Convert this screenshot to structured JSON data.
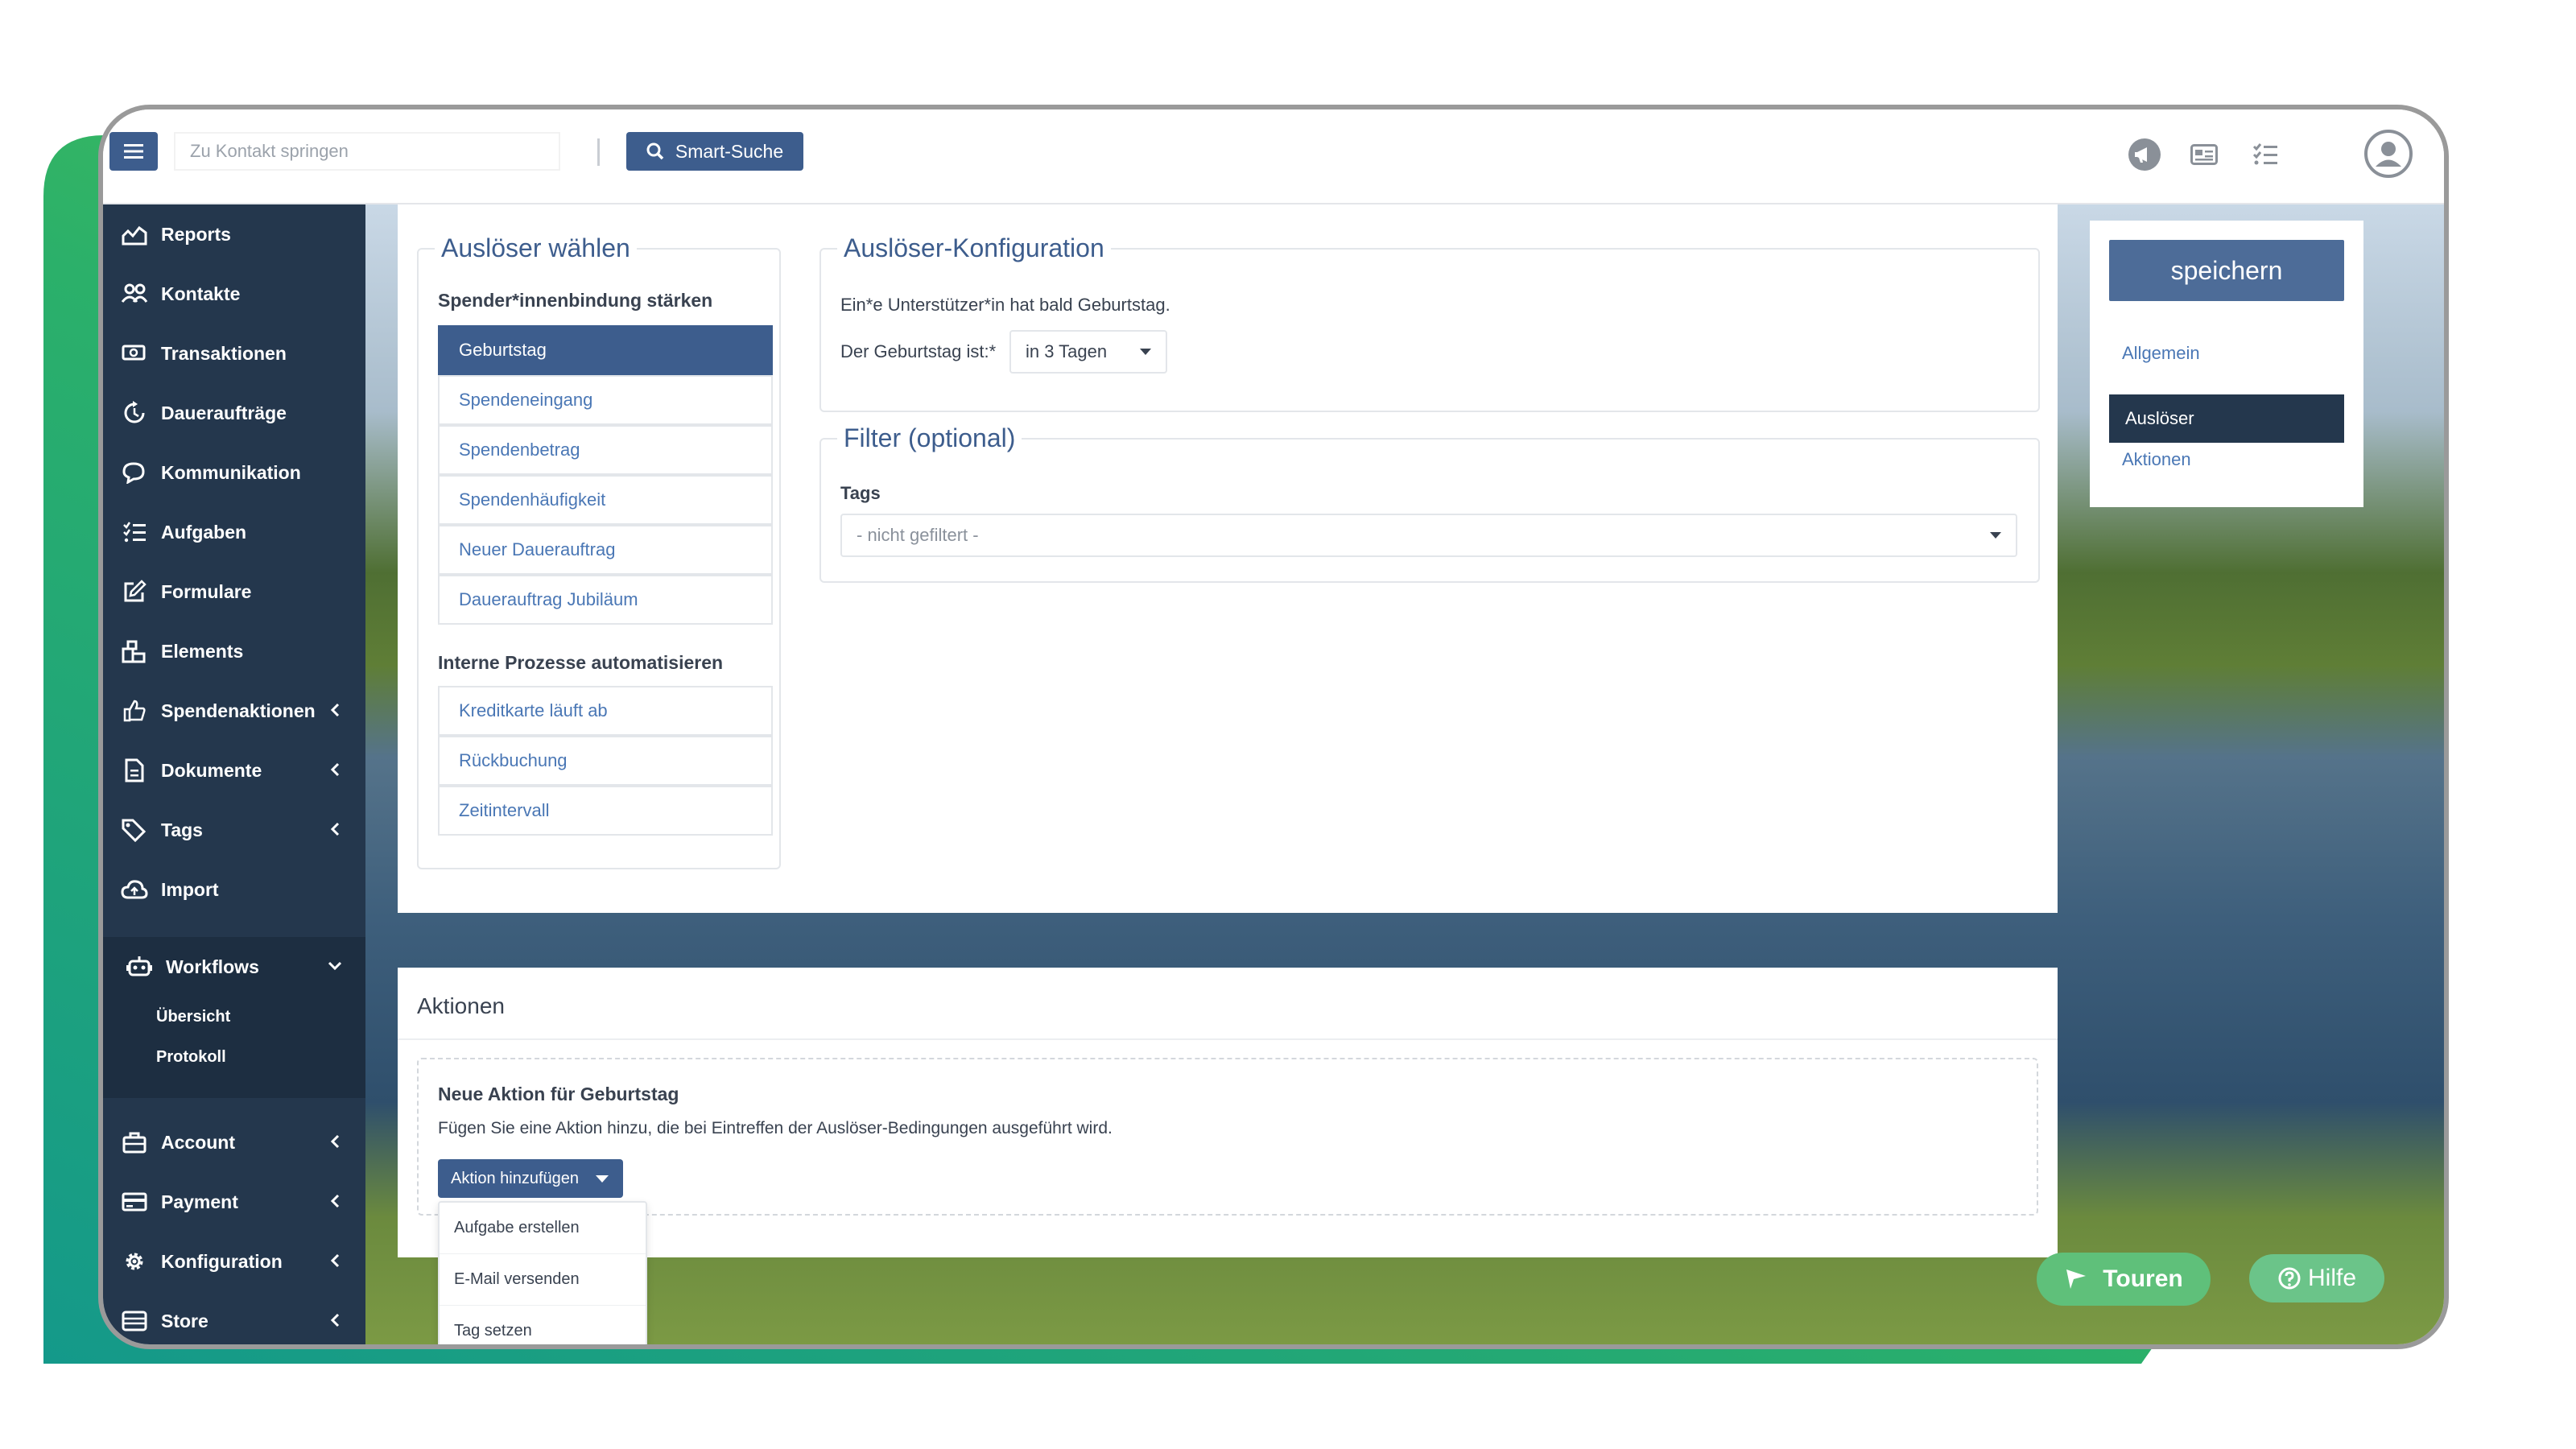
{
  "colors": {
    "primary": "#3d5d8d",
    "sidebar": "#24374d",
    "link": "#4a77b5",
    "accent_green": "#5fc07a",
    "deco_teal": "#1aa084"
  },
  "topbar": {
    "contact_search_placeholder": "Zu Kontakt springen",
    "smart_search_label": "Smart-Suche"
  },
  "sidebar": {
    "items": [
      {
        "label": "Reports",
        "icon": "chart-icon"
      },
      {
        "label": "Kontakte",
        "icon": "users-icon"
      },
      {
        "label": "Transaktionen",
        "icon": "money-icon"
      },
      {
        "label": "Daueraufträge",
        "icon": "recurring-icon"
      },
      {
        "label": "Kommunikation",
        "icon": "chat-icon"
      },
      {
        "label": "Aufgaben",
        "icon": "tasks-icon"
      },
      {
        "label": "Formulare",
        "icon": "edit-icon"
      },
      {
        "label": "Elements",
        "icon": "elements-icon"
      },
      {
        "label": "Spendenaktionen",
        "icon": "thumbs-up-icon"
      },
      {
        "label": "Dokumente",
        "icon": "document-icon"
      },
      {
        "label": "Tags",
        "icon": "tag-icon"
      },
      {
        "label": "Import",
        "icon": "cloud-upload-icon"
      },
      {
        "label": "Workflows",
        "icon": "robot-icon"
      },
      {
        "label": "Account",
        "icon": "briefcase-icon"
      },
      {
        "label": "Payment",
        "icon": "credit-card-icon"
      },
      {
        "label": "Konfiguration",
        "icon": "gear-icon"
      },
      {
        "label": "Store",
        "icon": "store-icon"
      }
    ],
    "workflows_sub": [
      "Übersicht",
      "Protokoll"
    ]
  },
  "trigger_select": {
    "title": "Auslöser wählen",
    "group1_label": "Spender*innenbindung stärken",
    "group1_items": [
      "Geburtstag",
      "Spendeneingang",
      "Spendenbetrag",
      "Spendenhäufigkeit",
      "Neuer Dauerauftrag",
      "Dauerauftrag Jubiläum"
    ],
    "group2_label": "Interne Prozesse automatisieren",
    "group2_items": [
      "Kreditkarte läuft ab",
      "Rückbuchung",
      "Zeitintervall"
    ]
  },
  "trigger_config": {
    "title": "Auslöser-Konfiguration",
    "description": "Ein*e Unterstützer*in hat bald Geburtstag.",
    "field_label": "Der Geburtstag ist:*",
    "field_value": "in 3 Tagen"
  },
  "filter": {
    "title": "Filter (optional)",
    "tags_label": "Tags",
    "tags_value": "- nicht gefiltert -"
  },
  "save_panel": {
    "save_label": "speichern",
    "links": [
      "Allgemein",
      "Auslöser",
      "Aktionen"
    ]
  },
  "actions": {
    "title": "Aktionen",
    "new_action_title": "Neue Aktion für Geburtstag",
    "new_action_desc": "Fügen Sie eine Aktion hinzu, die bei Eintreffen der Auslöser-Bedingungen ausgeführt wird.",
    "add_button": "Aktion hinzufügen",
    "dropdown_items": [
      "Aufgabe erstellen",
      "E-Mail versenden",
      "Tag setzen"
    ]
  },
  "floating": {
    "tours_label": "Touren",
    "help_label": "Hilfe"
  }
}
